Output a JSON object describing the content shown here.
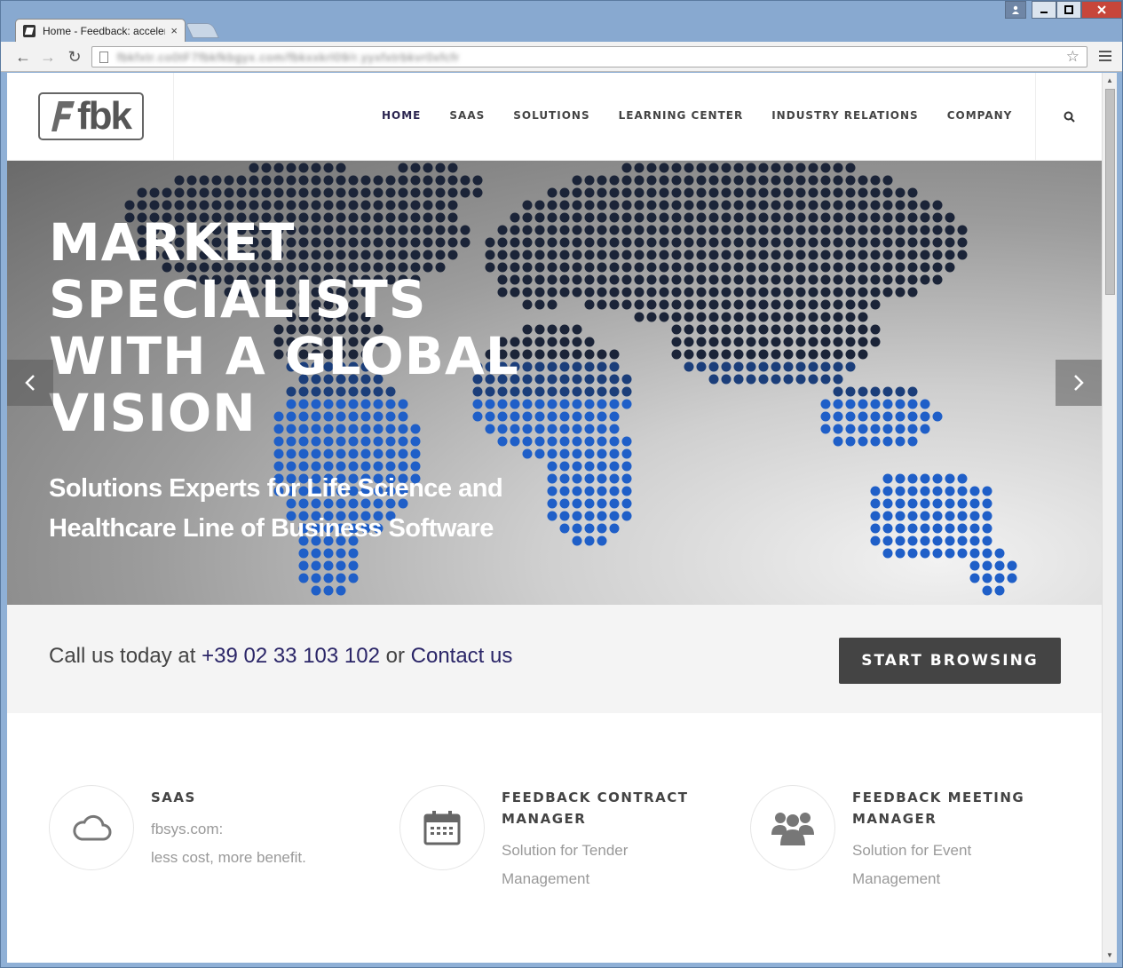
{
  "browser": {
    "tab_title": "Home - Feedback: acceler",
    "tab_close": "×",
    "back_icon": "←",
    "forward_icon": "→",
    "reload_icon": "↻",
    "star_icon": "☆",
    "url": "fbkfxtr.co0tF7fbkfkbgyx.com/fbkxxkrl09/r.yyxfxtrbkvr0xfcfr"
  },
  "site": {
    "nav": [
      "HOME",
      "SAAS",
      "SOLUTIONS",
      "LEARNING CENTER",
      "INDUSTRY RELATIONS",
      "COMPANY"
    ],
    "logo_text": "fbk"
  },
  "hero": {
    "title_lines": [
      "MARKET",
      "SPECIALISTS",
      "WITH A GLOBAL",
      "VISION"
    ],
    "subtitle_lines": [
      "Solutions Experts for Life Science and",
      "Healthcare Line of Business Software"
    ],
    "prev_icon": "‹",
    "next_icon": "›"
  },
  "cta": {
    "prefix": "Call us today at ",
    "phone": "+39 02 33 103 102",
    "middle": " or ",
    "contact": "Contact us",
    "button": "START BROWSING"
  },
  "features": [
    {
      "icon": "cloud-icon",
      "title": "SAAS",
      "lines": [
        "fbsys.com:",
        "less cost, more benefit."
      ]
    },
    {
      "icon": "calendar-icon",
      "title": "FEEDBACK CONTRACT MANAGER",
      "lines": [
        "Solution for Tender",
        "Management"
      ]
    },
    {
      "icon": "users-icon",
      "title": "FEEDBACK MEETING MANAGER",
      "lines": [
        "Solution for Event",
        "Management"
      ]
    }
  ],
  "colors": {
    "accent": "#2b2668",
    "button": "#444444",
    "cta_bg": "#f4f4f4"
  }
}
